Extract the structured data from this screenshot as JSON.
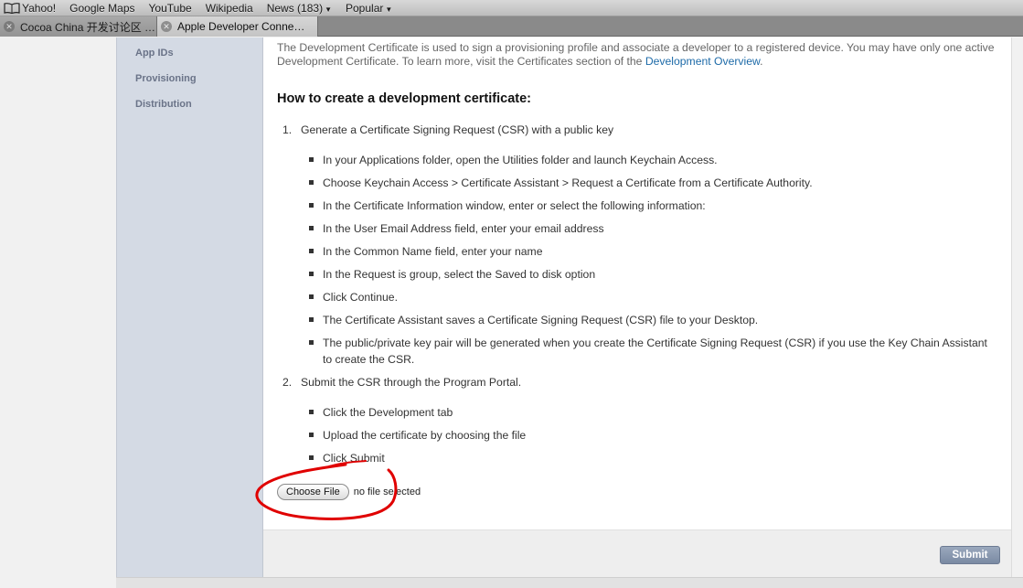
{
  "bookmarks": {
    "items": [
      "Yahoo!",
      "Google Maps",
      "YouTube",
      "Wikipedia",
      "News (183)",
      "Popular"
    ]
  },
  "tabs": [
    {
      "label": "Cocoa China 开发讨论区 …"
    },
    {
      "label": "Apple Developer Conne…"
    }
  ],
  "sidebar": {
    "items": [
      "App IDs",
      "Provisioning",
      "Distribution"
    ]
  },
  "main": {
    "intro_text": "The Development Certificate is used to sign a provisioning profile and associate a developer to a registered device. You may have only one active Development Certificate. To learn more, visit the Certificates section of the ",
    "intro_link": "Development Overview",
    "intro_end": ".",
    "heading": "How to create a development certificate:",
    "steps": [
      {
        "num": "1.",
        "text": "Generate a Certificate Signing Request (CSR) with a public key",
        "bullets": [
          "In your Applications folder, open the Utilities folder and launch Keychain Access.",
          "Choose Keychain Access > Certificate Assistant > Request a Certificate from a Certificate Authority.",
          "In the Certificate Information window, enter or select the following information:",
          "In the User Email Address field, enter your email address",
          "In the Common Name field, enter your name",
          "In the Request is group, select the Saved to disk option",
          "Click Continue.",
          "The Certificate Assistant saves a Certificate Signing Request (CSR) file to your Desktop.",
          "The public/private key pair will be generated when you create the Certificate Signing Request (CSR) if you use the Key Chain Assistant to create the CSR."
        ]
      },
      {
        "num": "2.",
        "text": "Submit the CSR through the Program Portal.",
        "bullets": [
          "Click the Development tab",
          "Upload the certificate by choosing the file",
          "Click Submit"
        ]
      }
    ],
    "file_input": {
      "button_label": "Choose File",
      "status": "no file selected"
    },
    "submit_label": "Submit"
  },
  "colors": {
    "sidebar_bg": "#d4dae4",
    "link": "#1d6aa8",
    "submit_bg": "#8998af",
    "annotation": "#e00000"
  },
  "icons": {
    "bookmarks": "open-book-icon",
    "tab_close": "close-icon"
  }
}
